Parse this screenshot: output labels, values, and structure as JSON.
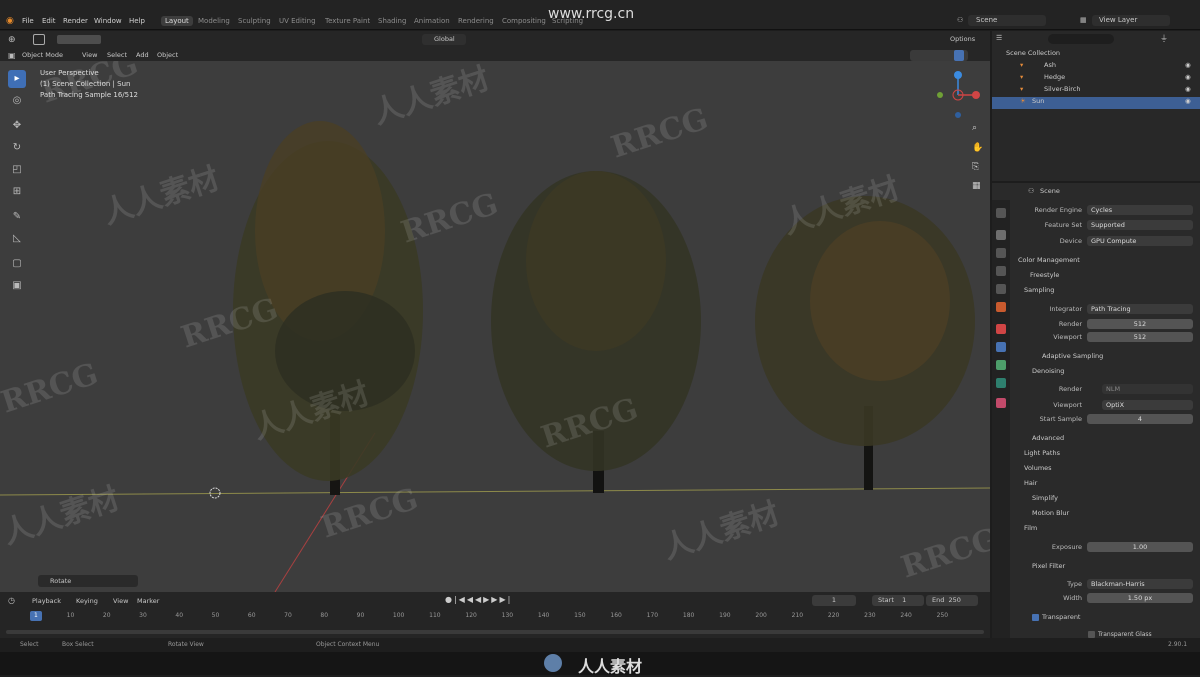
{
  "watermark_url": "www.rrcg.cn",
  "watermark_text": [
    "RRCG",
    "人人素材"
  ],
  "topbar": {
    "menus": [
      "File",
      "Edit",
      "Render",
      "Window",
      "Help"
    ],
    "workspaces": [
      "Layout",
      "Modeling",
      "Sculpting",
      "UV Editing",
      "Texture Paint",
      "Shading",
      "Animation",
      "Rendering",
      "Compositing",
      "Scripting"
    ],
    "scene": "Scene",
    "view_layer": "View Layer"
  },
  "viewport_header": {
    "mode": "Object Mode",
    "menus": [
      "View",
      "Select",
      "Add",
      "Object"
    ],
    "transform": "Global",
    "options": "Options"
  },
  "viewport": {
    "overlay": [
      "User Perspective",
      "(1) Scene Collection | Sun",
      "Path Tracing Sample 16/512"
    ],
    "last_op": "Rotate"
  },
  "outliner": {
    "root": "Scene Collection",
    "items": [
      "Ash",
      "Hedge",
      "Silver-Birch",
      "Sun"
    ]
  },
  "properties": {
    "context": "Scene",
    "render_engine": {
      "label": "Render Engine",
      "value": "Cycles"
    },
    "feature_set": {
      "label": "Feature Set",
      "value": "Supported"
    },
    "device": {
      "label": "Device",
      "value": "GPU Compute"
    },
    "sections": [
      "Color Management",
      "Freestyle",
      "Sampling"
    ],
    "integrator": {
      "label": "Integrator",
      "value": "Path Tracing"
    },
    "render": {
      "label": "Render",
      "value": "512"
    },
    "viewport": {
      "label": "Viewport",
      "value": "512"
    },
    "adaptive": "Adaptive Sampling",
    "denoising": "Denoising",
    "dn_render": {
      "label": "Render",
      "value": "NLM"
    },
    "dn_viewport": {
      "label": "Viewport",
      "value": "OptiX"
    },
    "start_sample": {
      "label": "Start Sample",
      "value": "4"
    },
    "more": [
      "Advanced",
      "Light Paths",
      "Volumes",
      "Hair",
      "Simplify",
      "Motion Blur",
      "Film"
    ],
    "exposure": {
      "label": "Exposure",
      "value": "1.00"
    },
    "pixel_filter": "Pixel Filter",
    "ptype": {
      "label": "Type",
      "value": "Blackman-Harris"
    },
    "width": {
      "label": "Width",
      "value": "1.50 px"
    },
    "transparent": "Transparent",
    "transparent_glass": "Transparent Glass"
  },
  "timeline": {
    "menus": [
      "Playback",
      "Keying",
      "View",
      "Marker"
    ],
    "current": "1",
    "start_label": "Start",
    "start": "1",
    "end_label": "End",
    "end": "250",
    "frames": [
      "1",
      "10",
      "20",
      "30",
      "40",
      "50",
      "60",
      "70",
      "80",
      "90",
      "100",
      "110",
      "120",
      "130",
      "140",
      "150",
      "160",
      "170",
      "180",
      "190",
      "200",
      "210",
      "220",
      "230",
      "240",
      "250"
    ]
  },
  "status": {
    "items": [
      "Select",
      "Box Select",
      "Rotate View",
      "Object Context Menu"
    ],
    "version": "2.90.1"
  },
  "colors": {
    "accent": "#4772b3",
    "bg": "#3c3c3c"
  }
}
